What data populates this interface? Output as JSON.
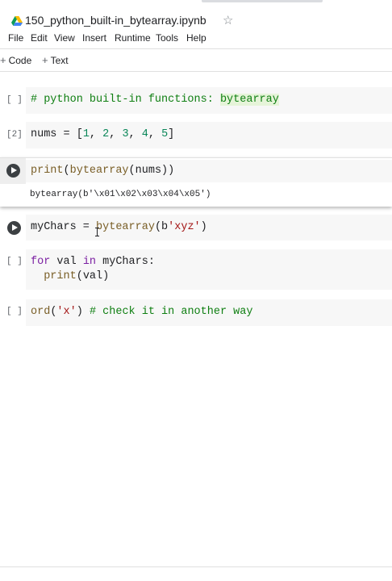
{
  "notebook": {
    "title": "150_python_built-in_bytearray.ipynb",
    "star_icon": "star-outline-icon",
    "drive_icon": "google-drive-icon"
  },
  "menu": [
    "File",
    "Edit",
    "View",
    "Insert",
    "Runtime",
    "Tools",
    "Help"
  ],
  "toolbar": {
    "code_button": "Code",
    "text_button": "Text",
    "plus": "+"
  },
  "cells": {
    "c1": {
      "exec": "[ ]",
      "comment": "# python built-in functions: ",
      "comment_highlight": "bytearray"
    },
    "c2": {
      "exec": "[2]",
      "p1": "nums = [",
      "n1": "1",
      "s1": ", ",
      "n2": "2",
      "s2": ", ",
      "n3": "3",
      "s3": ", ",
      "n4": "4",
      "s4": ", ",
      "n5": "5",
      "p2": "]"
    },
    "c3": {
      "fn1": "print",
      "p1": "(",
      "fn2": "bytearray",
      "p2": "(nums))",
      "output": "bytearray(b'\\x01\\x02\\x03\\x04\\x05')"
    },
    "c4": {
      "p1": "myChars = ",
      "fn1": "bytearray",
      "p2": "(b",
      "str": "'xyz'",
      "p3": ")"
    },
    "c5": {
      "exec": "[ ]",
      "kw1": "for",
      "p1": " val ",
      "kw2": "in",
      "p2": " myChars:",
      "indent": "  ",
      "fn1": "print",
      "p3": "(val)"
    },
    "c6": {
      "exec": "[ ]",
      "fn1": "ord",
      "p1": "(",
      "str": "'x'",
      "p2": ") ",
      "comment": "# check it in another way"
    }
  }
}
